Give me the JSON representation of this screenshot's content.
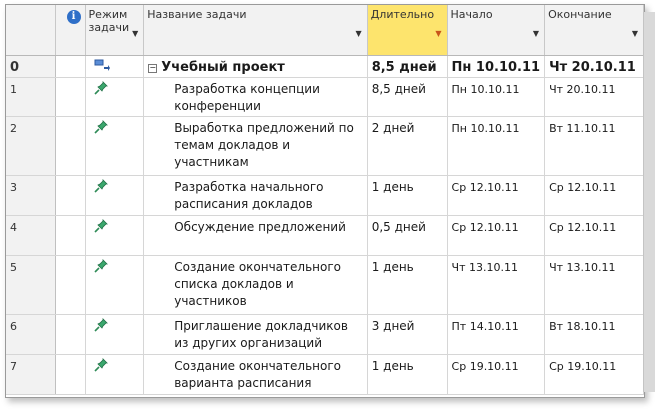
{
  "header": {
    "info_icon": "info-icon",
    "mode": "Режим задачи",
    "name": "Название задачи",
    "duration": "Длительно",
    "start": "Начало",
    "finish": "Окончание"
  },
  "rows": [
    {
      "id": "0",
      "mode_icon": "summary-mode-icon",
      "name": "Учебный проект",
      "duration": "8,5 дней",
      "start": "Пн 10.10.11",
      "finish": "Чт 20.10.11"
    },
    {
      "id": "1",
      "mode_icon": "pin-icon",
      "name": "Разработка концепции конференции",
      "duration": "8,5 дней",
      "start": "Пн 10.10.11",
      "finish": "Чт 20.10.11"
    },
    {
      "id": "2",
      "mode_icon": "pin-icon",
      "name": "Выработка предложений по темам докладов и участникам",
      "duration": "2 дней",
      "start": "Пн 10.10.11",
      "finish": "Вт 11.10.11"
    },
    {
      "id": "3",
      "mode_icon": "pin-icon",
      "name": "Разработка начального расписания докладов",
      "duration": "1 день",
      "start": "Ср 12.10.11",
      "finish": "Ср 12.10.11"
    },
    {
      "id": "4",
      "mode_icon": "pin-icon",
      "name": "Обсуждение предложений",
      "duration": "0,5 дней",
      "start": "Ср 12.10.11",
      "finish": "Ср 12.10.11"
    },
    {
      "id": "5",
      "mode_icon": "pin-icon",
      "name": "Создание окончательного списка докладов и участников",
      "duration": "1 день",
      "start": "Чт 13.10.11",
      "finish": "Чт 13.10.11"
    },
    {
      "id": "6",
      "mode_icon": "pin-icon",
      "name": "Приглашение докладчиков из других организаций",
      "duration": "3 дней",
      "start": "Пт 14.10.11",
      "finish": "Вт 18.10.11"
    },
    {
      "id": "7",
      "mode_icon": "pin-icon",
      "name": "Создание окончательного варианта расписания",
      "duration": "1 день",
      "start": "Ср 19.10.11",
      "finish": "Ср 19.10.11"
    }
  ]
}
